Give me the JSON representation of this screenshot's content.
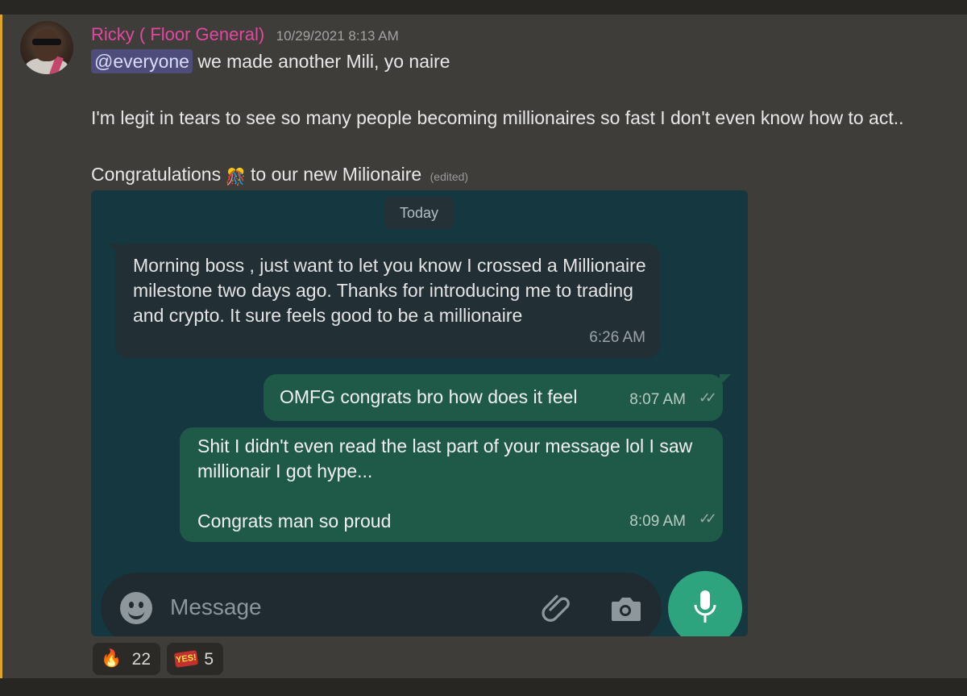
{
  "message": {
    "username": "Ricky ( Floor General)",
    "timestamp": "10/29/2021 8:13 AM",
    "mention": "@everyone",
    "line1": "we made another Mili, yo naire",
    "line2": "I'm legit in tears to see so many people becoming millionaires so fast I don't even know how to act..",
    "line3_before": "Congratulations",
    "line3_after": "to our new Milionaire",
    "edited": "(edited)",
    "inline_emoji": "🎊"
  },
  "chat": {
    "date_chip": "Today",
    "incoming": {
      "text": "Morning boss , just want to let you know I crossed a Millionaire milestone two days ago. Thanks for introducing me to trading and crypto. It sure feels good to be a millionaire",
      "time": "6:26 AM"
    },
    "outgoing": [
      {
        "text": "OMFG congrats bro how does it feel",
        "time": "8:07 AM"
      },
      {
        "text": "Shit I didn't even read the last part of your message lol I saw millionair I got hype...\n\nCongrats man so proud",
        "time": "8:09 AM"
      }
    ],
    "input_placeholder": "Message",
    "icons": [
      "emoji-icon",
      "attach-icon",
      "camera-icon",
      "microphone-icon"
    ]
  },
  "reactions": [
    {
      "emoji": "🔥",
      "count": "22"
    },
    {
      "emoji": "YES!",
      "count": "5"
    }
  ],
  "colors": {
    "username": "#e2489f",
    "mention_bg": "#4d4c7a",
    "outgoing_bubble": "#1f5a48",
    "incoming_bubble": "#222f35",
    "mic_button": "#2da47e"
  }
}
